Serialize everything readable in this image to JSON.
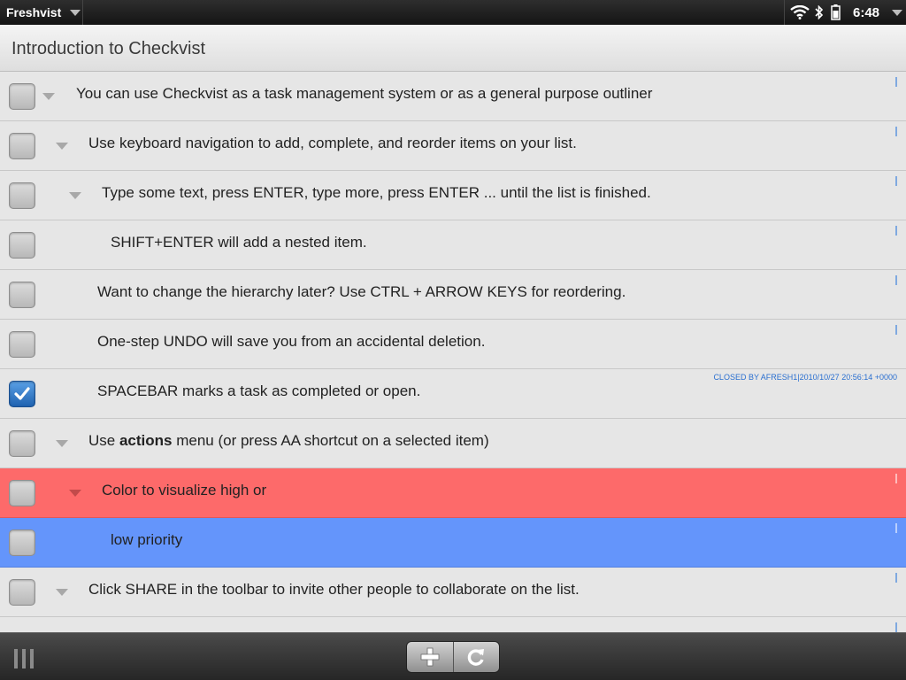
{
  "statusbar": {
    "app_name": "Freshvist",
    "time": "6:48",
    "icons": [
      "wifi-icon",
      "bluetooth-icon",
      "battery-icon",
      "chevron-down-icon"
    ]
  },
  "title": "Introduction to Checkvist",
  "items": [
    {
      "text": "You can use Checkvist as a task management system or as a general purpose outliner",
      "checked": false,
      "expander": true
    },
    {
      "text": "Use keyboard navigation to add, complete, and reorder items on your list.",
      "checked": false,
      "expander": true
    },
    {
      "text": "Type some text, press ENTER, type more, press ENTER ... until the list is finished.",
      "checked": false,
      "expander": true
    },
    {
      "text": "SHIFT+ENTER will add a nested item.",
      "checked": false,
      "expander": false
    },
    {
      "text": "Want to change the hierarchy later? Use CTRL + ARROW KEYS for reordering.",
      "checked": false,
      "expander": false
    },
    {
      "text": "One-step UNDO will save you from an accidental deletion.",
      "checked": false,
      "expander": false
    },
    {
      "text": "SPACEBAR marks a task as completed or open.",
      "checked": true,
      "expander": false,
      "note": "CLOSED BY AFRESH1|2010/10/27 20:56:14 +0000"
    },
    {
      "text_before": "Use ",
      "text_bold": "actions",
      "text_after": " menu (or press AA shortcut on a selected item)",
      "checked": false,
      "expander": true
    },
    {
      "text": "Color to visualize high or",
      "checked": false,
      "expander": true,
      "color": "#fd6a6a"
    },
    {
      "text": "low priority",
      "checked": false,
      "expander": false,
      "color": "#6495fb"
    },
    {
      "text": "Click SHARE in the toolbar to invite other people to collaborate on the list.",
      "checked": false,
      "expander": true
    }
  ],
  "toolbar": {
    "buttons": [
      "plus-icon",
      "refresh-icon"
    ]
  }
}
